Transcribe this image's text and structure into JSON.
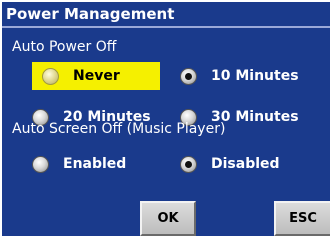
{
  "window": {
    "title": "Power Management"
  },
  "auto_power_off": {
    "heading": "Auto Power Off",
    "options": [
      {
        "label": "Never",
        "selected": false,
        "highlighted": true
      },
      {
        "label": "10 Minutes",
        "selected": true,
        "highlighted": false
      },
      {
        "label": "20 Minutes",
        "selected": false,
        "highlighted": false
      },
      {
        "label": "30 Minutes",
        "selected": false,
        "highlighted": false
      }
    ]
  },
  "auto_screen_off": {
    "heading": "Auto Screen Off (Music Player)",
    "options": [
      {
        "label": "Enabled",
        "selected": false
      },
      {
        "label": "Disabled",
        "selected": true
      }
    ]
  },
  "buttons": {
    "ok": "OK",
    "esc": "ESC"
  },
  "colors": {
    "panel": "#1a3a8c",
    "highlight": "#f5f000",
    "button": "#c8c8c8"
  }
}
